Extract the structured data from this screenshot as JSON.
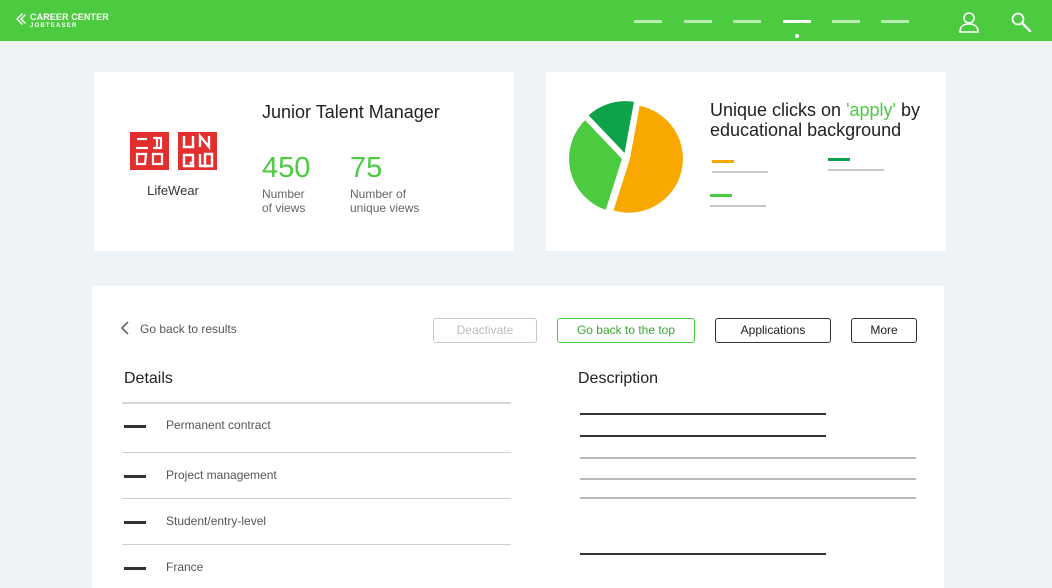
{
  "colors": {
    "brand_green": "#4ccb41",
    "accent_orange": "#f9a800",
    "dark_green": "#0ea34a",
    "logo_red": "#e22e2c"
  },
  "header": {
    "brand_line1": "CAREER CENTER",
    "brand_line2": "JOBTEASER",
    "nav_count": 6,
    "active_nav": 4,
    "icons": [
      "profile-icon",
      "search-icon"
    ]
  },
  "job": {
    "logo_text": {
      "left": "ユニクロ",
      "right": "UNIQLO"
    },
    "logo_caption": "LifeWear",
    "title": "Junior Talent Manager",
    "views": "450",
    "views_label": "Number\nof views",
    "unique_views": "75",
    "unique_views_label": "Number of\nunique views"
  },
  "chart_card": {
    "title_before": "Unique clicks on ",
    "title_accent": "'apply'",
    "title_after": " by",
    "title_line2": "educational background"
  },
  "chart_data": {
    "type": "pie",
    "title": "Unique clicks on 'apply' by educational background",
    "values": [
      52,
      33,
      15
    ],
    "colors": [
      "#f9a800",
      "#4ccb41",
      "#0ea34a"
    ]
  },
  "actions": {
    "back_label": "Go back to results",
    "deactivate_label": "Deactivate",
    "top_label": "Go back to the top",
    "applications_label": "Applications",
    "more_label": "More"
  },
  "details": {
    "title": "Details",
    "items": [
      "Permanent contract",
      "Project management",
      "Student/entry-level",
      "France"
    ]
  },
  "description": {
    "title": "Description"
  }
}
